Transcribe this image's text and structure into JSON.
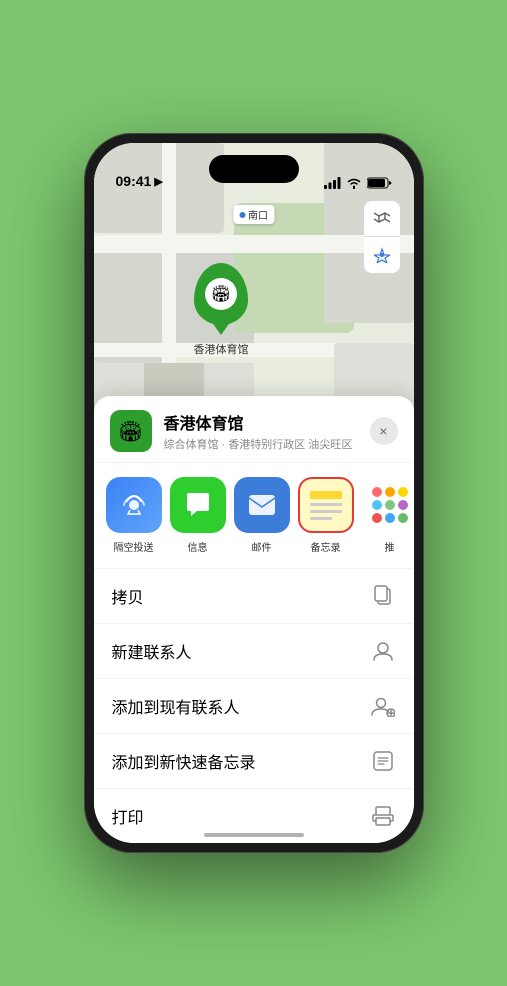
{
  "statusBar": {
    "time": "09:41",
    "timeIcon": "▶",
    "signal": "signal-icon",
    "wifi": "wifi-icon",
    "battery": "battery-icon"
  },
  "map": {
    "northLabel": "南口",
    "pinLabel": "香港体育馆",
    "controlMap": "🗺",
    "controlLocation": "↗"
  },
  "sheet": {
    "venueName": "香港体育馆",
    "venueSubtitle": "综合体育馆 · 香港特别行政区 油尖旺区",
    "closeLabel": "×",
    "shareItems": [
      {
        "id": "airdrop",
        "label": "隔空投送",
        "type": "airdrop"
      },
      {
        "id": "message",
        "label": "信息",
        "type": "message"
      },
      {
        "id": "mail",
        "label": "邮件",
        "type": "mail"
      },
      {
        "id": "notes",
        "label": "备忘录",
        "type": "notes"
      },
      {
        "id": "more",
        "label": "推",
        "type": "more"
      }
    ],
    "actionItems": [
      {
        "id": "copy",
        "label": "拷贝",
        "icon": "copy"
      },
      {
        "id": "new-contact",
        "label": "新建联系人",
        "icon": "person"
      },
      {
        "id": "add-contact",
        "label": "添加到现有联系人",
        "icon": "person-add"
      },
      {
        "id": "quick-note",
        "label": "添加到新快速备忘录",
        "icon": "note"
      },
      {
        "id": "print",
        "label": "打印",
        "icon": "print"
      }
    ]
  }
}
